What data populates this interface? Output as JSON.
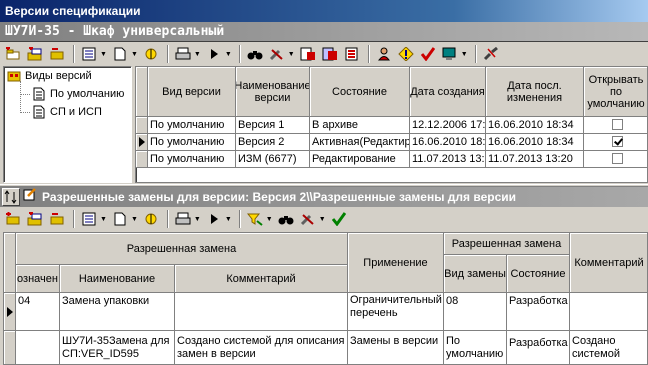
{
  "window": {
    "title": "Версии спецификации"
  },
  "header": {
    "title": "ШУ7И-35 - Шкаф универсальный"
  },
  "tree": {
    "items": [
      {
        "label": "Виды версий",
        "level": 0
      },
      {
        "label": "По умолчанию",
        "level": 1
      },
      {
        "label": "СП и ИСП",
        "level": 1
      }
    ]
  },
  "versions": {
    "columns": [
      "Вид версии",
      "Наименование версии",
      "Состояние",
      "Дата создания",
      "Дата посл. изменения",
      "Открывать по умолчанию"
    ],
    "rows": [
      {
        "kind": "По умолчанию",
        "name": "Версия 1",
        "state": "В архиве",
        "created": "12.12.2006 17:",
        "modified": "16.06.2010 18:34",
        "open_default": false,
        "current": false
      },
      {
        "kind": "По умолчанию",
        "name": "Версия 2",
        "state": "Активная(Редактир",
        "created": "16.06.2010 18:",
        "modified": "16.06.2010 18:34",
        "open_default": true,
        "current": true
      },
      {
        "kind": "По умолчанию",
        "name": "ИЗМ (6677)",
        "state": "Редактирование",
        "created": "11.07.2013 13:",
        "modified": "11.07.2013 13:20",
        "open_default": false,
        "current": false
      }
    ]
  },
  "replacements": {
    "title": "Разрешенные замены для версии: Версия 2\\\\Разрешенные замены для версии",
    "group1": "Разрешенная замена",
    "group2": "Разрешенная замена",
    "col_designation": "означен",
    "col_name": "Наименование",
    "col_comment": "Комментарий",
    "col_application": "Применение",
    "col_kind": "Вид замены",
    "col_state": "Состояние",
    "col_comment2": "Комментарий",
    "rows": [
      {
        "designation": "04",
        "name": "Замена упаковки",
        "comment": "",
        "application": "Ограничительный перечень",
        "kind": "08",
        "state": "Разработка",
        "comment2": "",
        "current": true
      },
      {
        "designation": "",
        "name": "ШУ7И-35Замена для СП:VER_ID595",
        "comment": "Создано системой для описания замен в версии",
        "application": "Замены в версии",
        "kind": "По умолчанию",
        "state": "Разработка",
        "comment2": "Создано системой",
        "current": false
      }
    ]
  },
  "colors": {
    "title_bar": "#0a246a",
    "header_gray": "#808080",
    "accent_red": "#cc0000",
    "accent_green": "#008000"
  }
}
